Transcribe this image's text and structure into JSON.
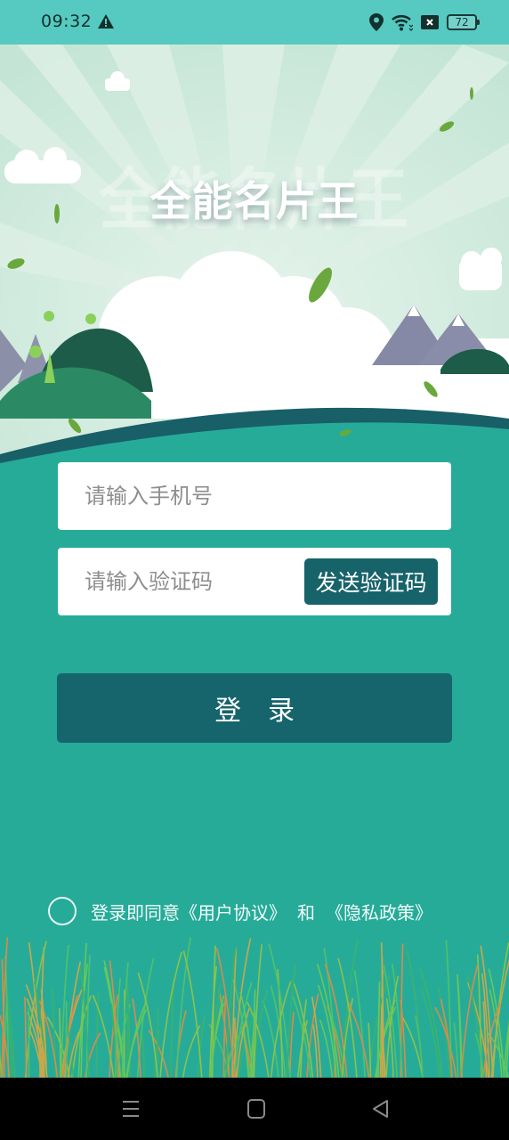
{
  "status_bar": {
    "time": "09:32",
    "alert_icon": "warning-triangle-icon",
    "icons": [
      "location-pin-icon",
      "wifi-icon",
      "sim-off-icon"
    ],
    "battery_level": "72"
  },
  "banner": {
    "app_title": "全能名片王"
  },
  "form": {
    "phone_placeholder": "请输入手机号",
    "phone_value": "",
    "code_placeholder": "请输入验证码",
    "code_value": "",
    "send_code_label": "发送验证码",
    "login_label": "登录"
  },
  "agreement": {
    "checked": false,
    "prefix": "登录即同意",
    "user_agreement": "《用户协议》",
    "and": "和",
    "privacy_policy": "《隐私政策》"
  },
  "nav_bar": {
    "buttons": [
      "menu-icon",
      "home-icon",
      "back-icon"
    ]
  },
  "colors": {
    "status_bar": "#56c9c0",
    "background": "#27ab99",
    "button": "#17656c",
    "sky": "#cde9dc"
  }
}
